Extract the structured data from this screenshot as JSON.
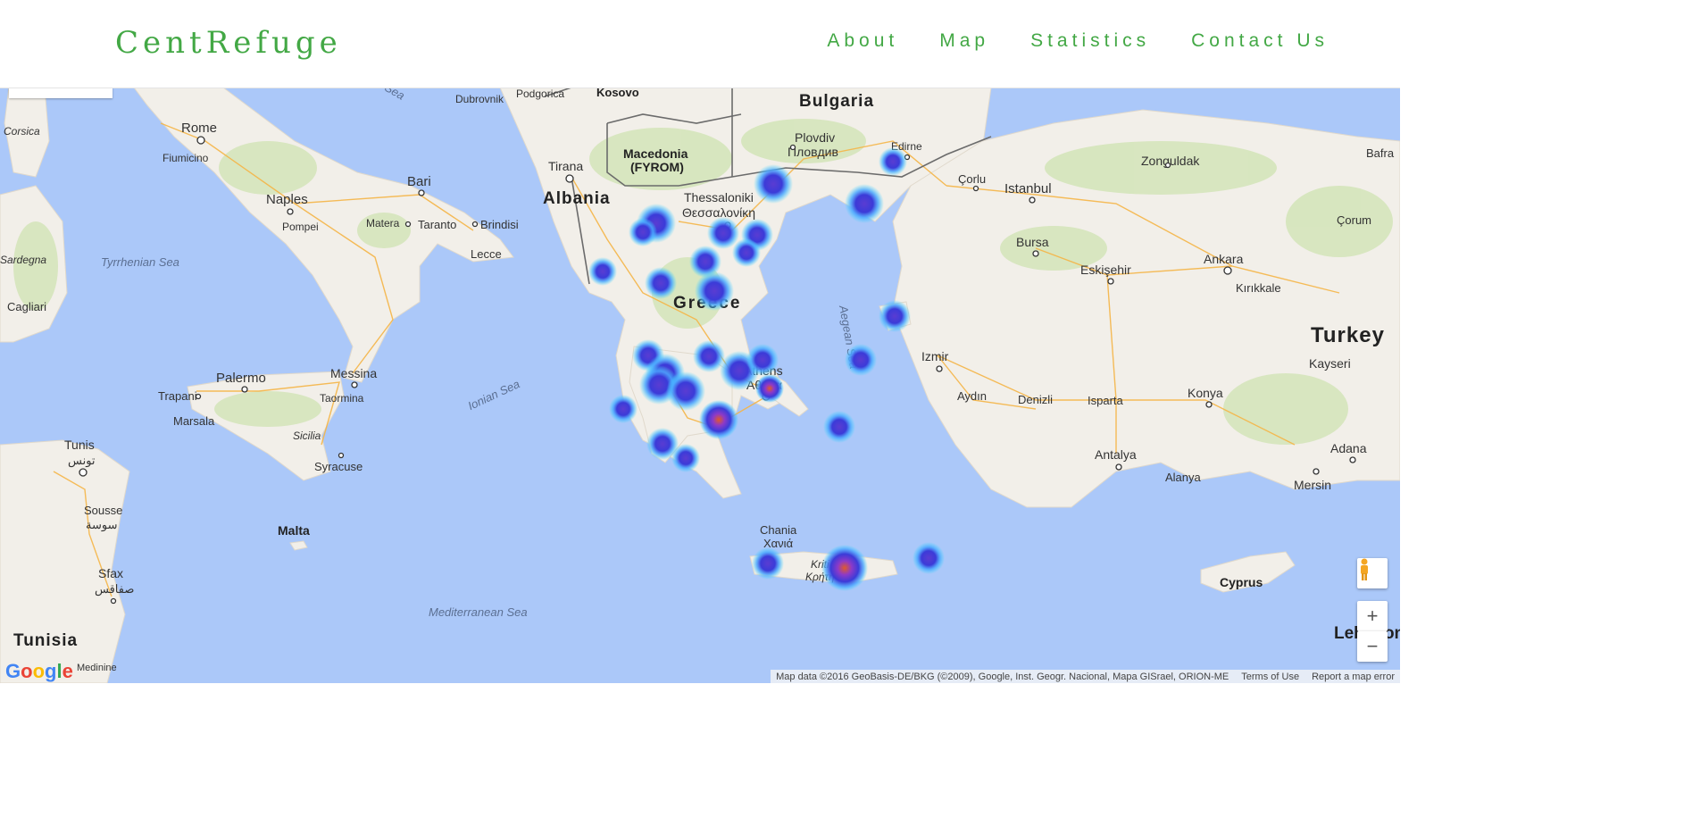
{
  "header": {
    "brand": "CentRefuge",
    "nav": [
      "About",
      "Map",
      "Statistics",
      "Contact Us"
    ]
  },
  "colors": {
    "brand_green": "#43a845",
    "sea": "#abc8f9",
    "land": "#f2efe9",
    "land_green": "#cfe3b1",
    "road": "#f5b547",
    "heat_blue": "#3b3bd8",
    "heat_glow": "#3fd8ff",
    "heat_hot": "#e05a2a"
  },
  "map": {
    "labels": {
      "countries": [
        "Bulgaria",
        "Macedonia",
        "(FYROM)",
        "Albania",
        "Kosovo",
        "Greece",
        "Turkey",
        "Tunisia",
        "Malta",
        "Cyprus",
        "Lebanon"
      ],
      "cities": [
        "Rome",
        "Fiumicino",
        "Naples",
        "Pompei",
        "Bari",
        "Matera",
        "Taranto",
        "Brindisi",
        "Lecce",
        "Palermo",
        "Trapani",
        "Marsala",
        "Messina",
        "Taormina",
        "Sicilia",
        "Syracuse",
        "Cagliari",
        "Sardegna",
        "Corsica",
        "Tunis",
        "تونس",
        "Sousse",
        "سوسة",
        "Sfax",
        "صفاقس",
        "Medinine",
        "Tirana",
        "Dubrovnik",
        "Podgorica",
        "Plovdiv",
        "Пловдив",
        "Edirne",
        "Thessaloniki",
        "Θεσσαλονίκη",
        "Athens",
        "Αθήνα",
        "Chania",
        "Χανιά",
        "Kriti",
        "Κρήτη",
        "Çorlu",
        "Istanbul",
        "Zonguldak",
        "Bafra",
        "Çorum",
        "Bursa",
        "Eskişehir",
        "Ankara",
        "Kırıkkale",
        "Izmir",
        "Aydın",
        "Denizli",
        "Isparta",
        "Konya",
        "Kayseri",
        "Antalya",
        "Alanya",
        "Adana",
        "Mersin"
      ],
      "seas": [
        "Tyrrhenian Sea",
        "Ionian Sea",
        "Aegean Sea",
        "Mediterranean Sea",
        "Sea"
      ]
    },
    "google": "Google",
    "attribution": [
      "Map data ©2016 GeoBasis-DE/BKG (©2009), Google, Inst. Geogr. Nacional, Mapa GISrael, ORION-ME",
      "Terms of Use",
      "Report a map error"
    ],
    "controls": {
      "pegman": "pegman-icon",
      "zoom_in": "+",
      "zoom_out": "−"
    },
    "heatmap": {
      "hotspots": 27,
      "legend": ""
    }
  }
}
